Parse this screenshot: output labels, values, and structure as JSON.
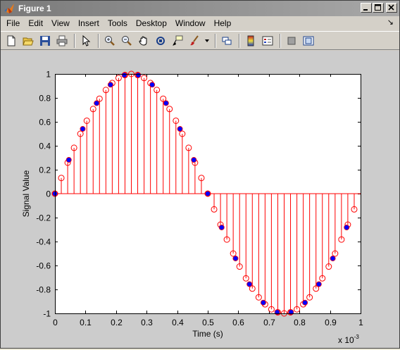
{
  "window": {
    "title": "Figure 1",
    "title_icon": "matlab-icon",
    "controls": [
      "minimize-icon",
      "maximize-icon",
      "close-icon"
    ]
  },
  "menu": {
    "items": [
      "File",
      "Edit",
      "View",
      "Insert",
      "Tools",
      "Desktop",
      "Window",
      "Help"
    ],
    "dock_arrow": "↘"
  },
  "toolbar": {
    "tools": [
      "new-figure-icon",
      "open-file-icon",
      "save-icon",
      "print-icon",
      "pointer-icon",
      "zoom-in-icon",
      "zoom-out-icon",
      "pan-icon",
      "rotate-3d-icon",
      "data-cursor-icon",
      "brush-icon",
      "brush-dropdown-icon",
      "link-plot-icon",
      "colorbar-icon",
      "legend-icon",
      "hide-plot-tools-icon",
      "show-plot-tools-icon"
    ]
  },
  "chart_data": {
    "type": "stem",
    "xlabel": "Time (s)",
    "ylabel": "Signal Value",
    "x_multiplier": "x 10",
    "x_multiplier_exp": "-3",
    "xlim": [
      0,
      1
    ],
    "ylim": [
      -1,
      1
    ],
    "x_ticks": [
      "0",
      "0.1",
      "0.2",
      "0.3",
      "0.4",
      "0.5",
      "0.6",
      "0.7",
      "0.8",
      "0.9",
      "1"
    ],
    "y_ticks": [
      "1",
      "0.8",
      "0.6",
      "0.4",
      "0.2",
      "0",
      "-0.2",
      "-0.4",
      "-0.6",
      "-0.8",
      "-1"
    ],
    "signal_frequency": 1000,
    "colors": {
      "stem": "#ff0000",
      "filled_marker": "#0000ff",
      "axes_bg": "#ffffff",
      "figure_bg": "#cccccc"
    },
    "series": [
      {
        "style": "stem-open-circle",
        "sample_interval": 2.083e-05,
        "x": [
          0,
          0.0208,
          0.0417,
          0.0625,
          0.0833,
          0.1042,
          0.125,
          0.1458,
          0.1667,
          0.1875,
          0.2083,
          0.2292,
          0.25,
          0.2708,
          0.2917,
          0.3125,
          0.3333,
          0.3542,
          0.375,
          0.3958,
          0.4167,
          0.4375,
          0.4583,
          0.4792,
          0.5,
          0.5208,
          0.5417,
          0.5625,
          0.5833,
          0.6042,
          0.625,
          0.6458,
          0.6667,
          0.6875,
          0.7083,
          0.7292,
          0.75,
          0.7708,
          0.7917,
          0.8125,
          0.8333,
          0.8542,
          0.875,
          0.8958,
          0.9167,
          0.9375,
          0.9583,
          0.9792
        ],
        "y": [
          0,
          0.131,
          0.259,
          0.383,
          0.5,
          0.609,
          0.707,
          0.793,
          0.866,
          0.924,
          0.966,
          0.991,
          1,
          0.991,
          0.966,
          0.924,
          0.866,
          0.793,
          0.707,
          0.609,
          0.5,
          0.383,
          0.259,
          0.131,
          0,
          -0.131,
          -0.259,
          -0.383,
          -0.5,
          -0.609,
          -0.707,
          -0.793,
          -0.866,
          -0.924,
          -0.966,
          -0.991,
          -1,
          -0.991,
          -0.966,
          -0.924,
          -0.866,
          -0.793,
          -0.707,
          -0.609,
          -0.5,
          -0.383,
          -0.259,
          -0.131
        ]
      },
      {
        "style": "filled-marker",
        "sample_interval": 4.545e-05,
        "x": [
          0,
          0.0455,
          0.0909,
          0.1364,
          0.1818,
          0.2273,
          0.2727,
          0.3182,
          0.3636,
          0.4091,
          0.4545,
          0.5,
          0.5455,
          0.5909,
          0.6364,
          0.6818,
          0.7273,
          0.7727,
          0.8182,
          0.8636,
          0.9091,
          0.9545
        ],
        "y": [
          0,
          0.282,
          0.541,
          0.756,
          0.91,
          0.99,
          0.99,
          0.91,
          0.756,
          0.541,
          0.282,
          0,
          -0.282,
          -0.541,
          -0.756,
          -0.91,
          -0.99,
          -0.99,
          -0.91,
          -0.756,
          -0.541,
          -0.282
        ]
      }
    ]
  }
}
